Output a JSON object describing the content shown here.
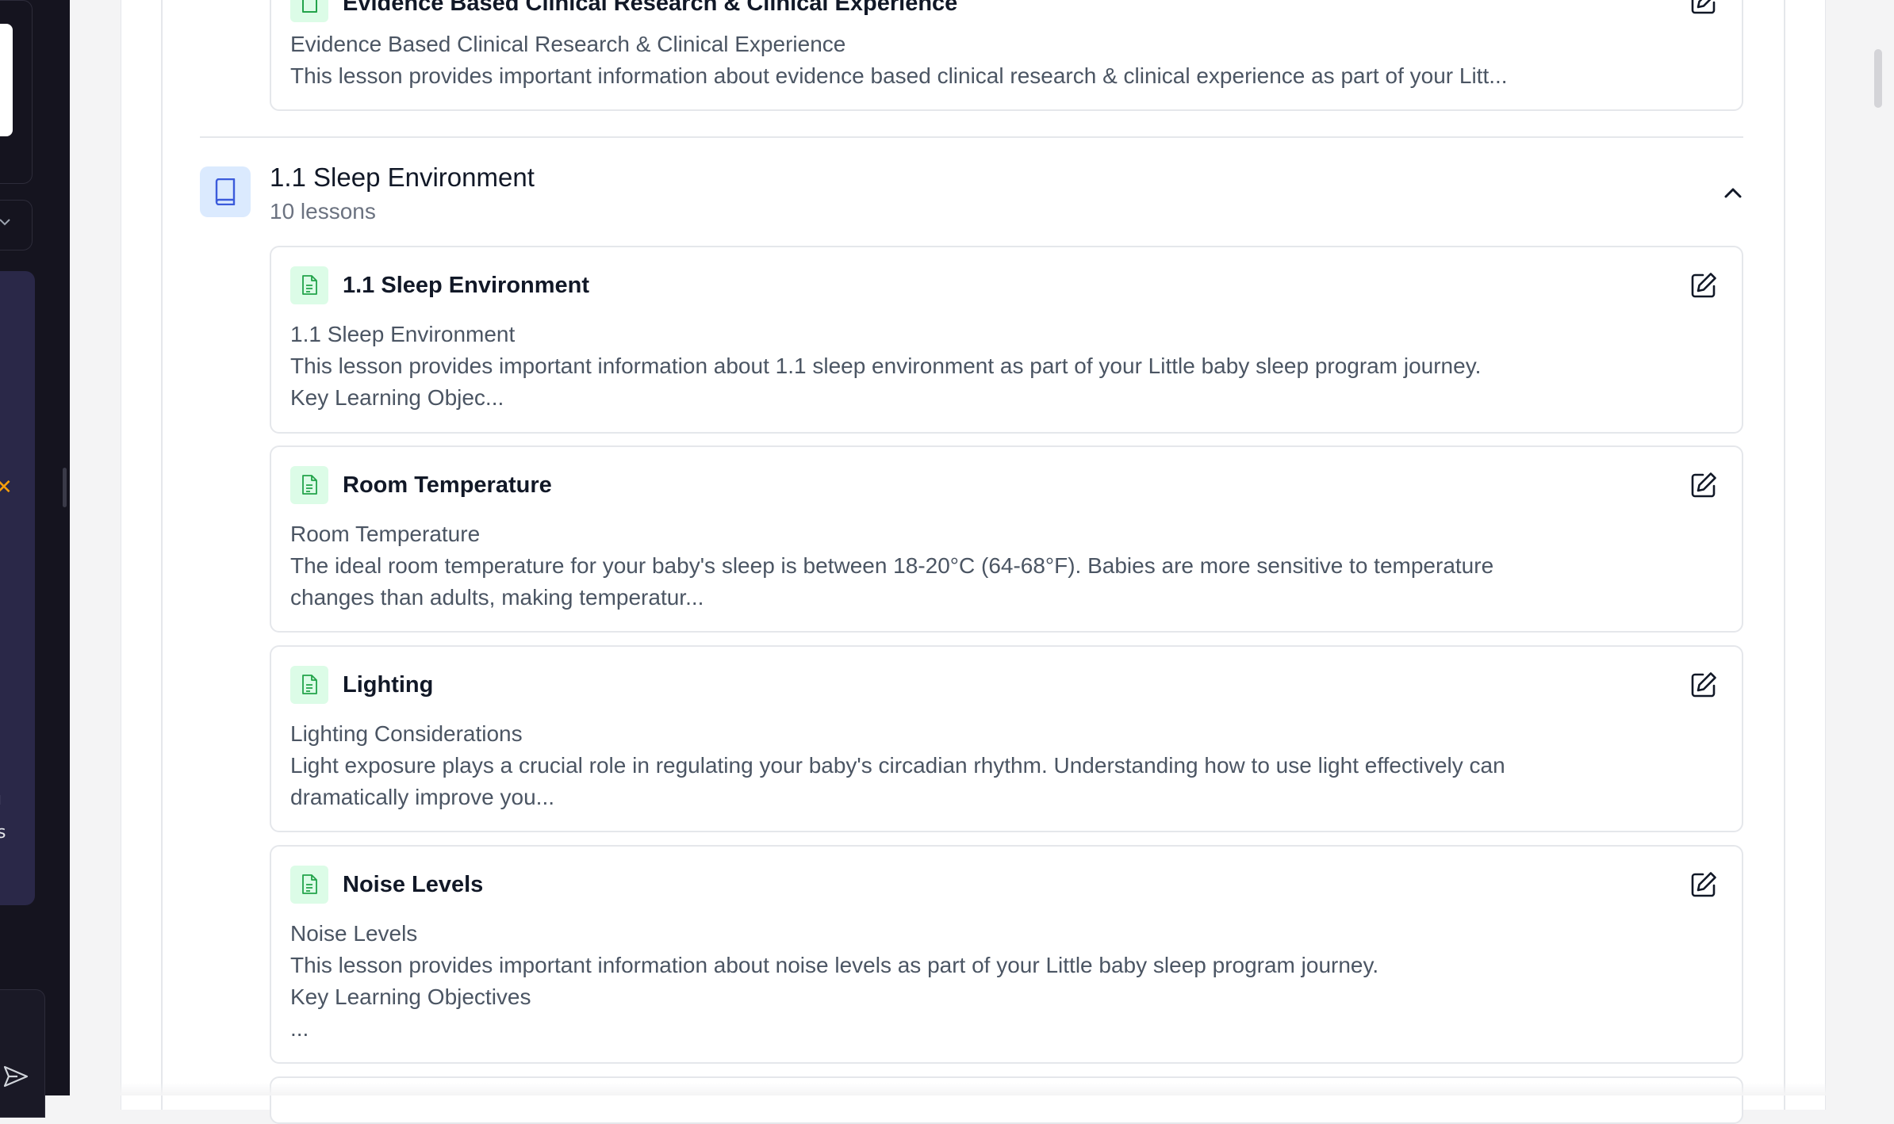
{
  "colors": {
    "sidebar_bg": "#15141f",
    "sidebar_accent": "#2a2848",
    "lesson_icon_bg": "#dcfce7",
    "lesson_icon_fg": "#22a34a",
    "module_icon_bg": "#dbeafe",
    "module_icon_fg": "#3b5bdb",
    "star": "#f59e0b"
  },
  "sidebar": {
    "star_glyph": "✕",
    "glyph_1": "ı",
    "glyph_2": "s"
  },
  "prev_module": {
    "last_lesson": {
      "title": "Evidence Based Clinical Research & Clinical Experience",
      "subtitle": "Evidence Based Clinical Research & Clinical Experience",
      "description": "This lesson provides important information about evidence based clinical research & clinical experience as part of your Litt...",
      "icon": "document-icon",
      "edit_icon": "edit-icon"
    }
  },
  "module": {
    "title": "1.1 Sleep Environment",
    "lesson_count": "10 lessons",
    "icon": "book-icon",
    "toggle_icon": "chevron-up-icon",
    "lessons": [
      {
        "title": "1.1 Sleep Environment",
        "subtitle": "1.1 Sleep Environment",
        "description_lines": [
          "This lesson provides important information about 1.1 sleep environment as part of your Little baby sleep program journey.",
          "Key Learning Objec..."
        ]
      },
      {
        "title": "Room Temperature",
        "subtitle": "Room Temperature",
        "description_lines": [
          "The ideal room temperature for your baby's sleep is between 18-20°C (64-68°F). Babies are more sensitive to temperature",
          "changes than adults, making temperatur..."
        ]
      },
      {
        "title": "Lighting",
        "subtitle": "Lighting Considerations",
        "description_lines": [
          "Light exposure plays a crucial role in regulating your baby's circadian rhythm. Understanding how to use light effectively can",
          "dramatically improve you..."
        ]
      },
      {
        "title": "Noise Levels",
        "subtitle": "Noise Levels",
        "description_lines": [
          "This lesson provides important information about noise levels as part of your Little baby sleep program journey.",
          "Key Learning Objectives",
          "..."
        ]
      }
    ]
  }
}
